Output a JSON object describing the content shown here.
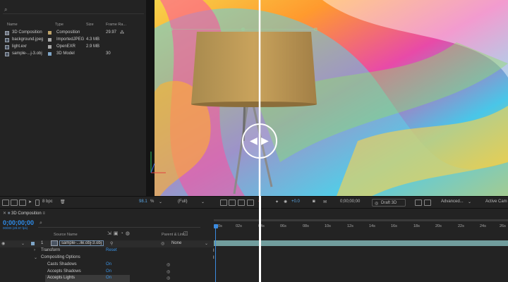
{
  "project": {
    "columns": {
      "name": "Name",
      "type": "Type",
      "size": "Size",
      "frame_rate": "Frame Ra..."
    },
    "items": [
      {
        "name": "3D Composition",
        "type": "Composition",
        "size": "",
        "frame_rate": "29.97",
        "type_color": "#bfa46a"
      },
      {
        "name": "background.jpeg",
        "type": "ImportedJPEG",
        "size": "4.3 MB",
        "frame_rate": "",
        "type_color": "#a9a9a9"
      },
      {
        "name": "light.exr",
        "type": "OpenEXR",
        "size": "2.9 MB",
        "frame_rate": "",
        "type_color": "#a9a9a9"
      },
      {
        "name": "sample-...j-3.obj",
        "type": "3D Model",
        "size": "",
        "frame_rate": "30",
        "type_color": "#7fa6c8"
      }
    ]
  },
  "viewer_toolbar": {
    "bpc": "8 bpc",
    "zoom": "98.1",
    "zoom_unit": "%",
    "resolution": "(Full)",
    "exposure": "+0.0",
    "timecode": "0;00;00;00",
    "renderer": "Draft 3D",
    "view_mode": "Advanced...",
    "camera": "Active Cam"
  },
  "timeline": {
    "tab": "3D Composition",
    "timecode": "0;00;00;00",
    "frame_info": "00000 (29.97 fps)",
    "columns": {
      "source": "Source Name",
      "parent": "Parent & Link"
    },
    "layer": {
      "number": "1",
      "name": "sample-...ile.obj-3.obj",
      "parent": "None"
    },
    "properties": [
      {
        "label": "Transform",
        "value": "Reset",
        "indent": 1
      },
      {
        "label": "Compositing Options",
        "value": "",
        "indent": 1
      },
      {
        "label": "Casts Shadows",
        "value": "On",
        "indent": 2
      },
      {
        "label": "Accepts Shadows",
        "value": "On",
        "indent": 2
      },
      {
        "label": "Accepts Lights",
        "value": "On",
        "indent": 2
      }
    ],
    "ruler_ticks": [
      "00s",
      "02s",
      "04s",
      "06s",
      "08s",
      "10s",
      "12s",
      "14s",
      "16s",
      "18s",
      "20s",
      "22s",
      "24s",
      "26s"
    ]
  },
  "colors": {
    "accent": "#2d8ceb",
    "panel": "#232323",
    "track": "#7fb3b3"
  }
}
